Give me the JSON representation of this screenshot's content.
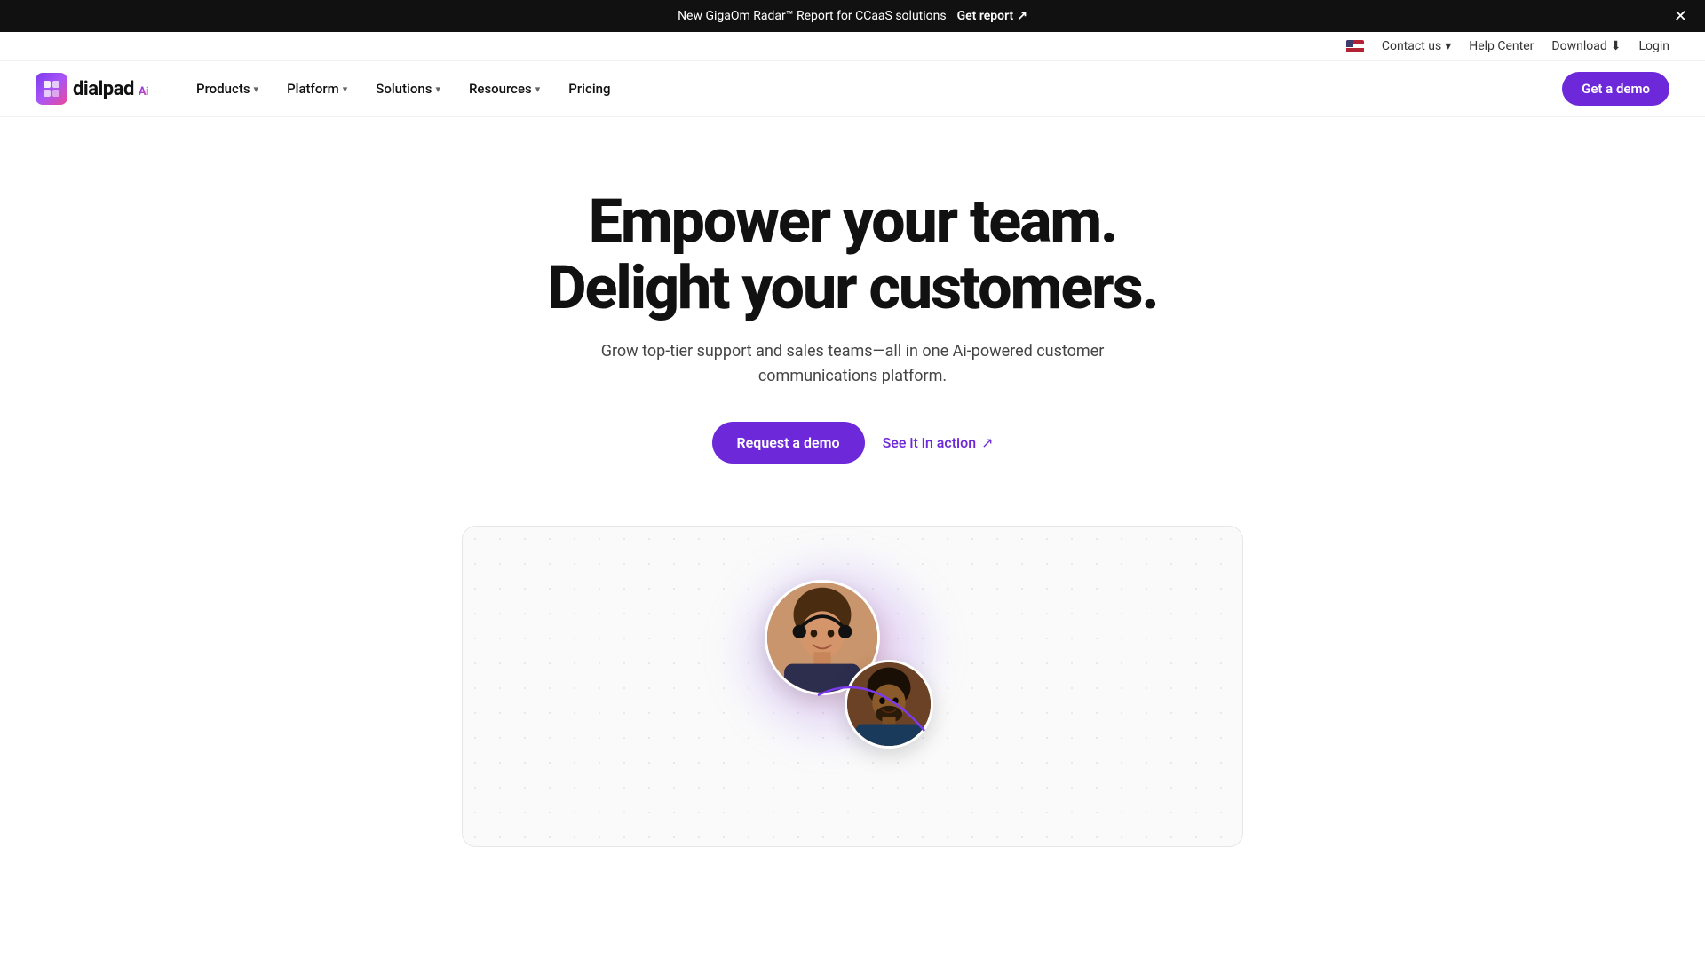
{
  "announcement": {
    "text": "New GigaOm Radar™ Report for CCaaS solutions",
    "cta_label": "Get report",
    "cta_icon": "↗"
  },
  "utility_nav": {
    "contact_label": "Contact us",
    "contact_chevron": "▾",
    "help_label": "Help Center",
    "download_label": "Download",
    "download_icon": "⬇",
    "login_label": "Login"
  },
  "nav": {
    "logo_text": "dialpad",
    "logo_ai": "Ai",
    "items": [
      {
        "label": "Products",
        "has_dropdown": true
      },
      {
        "label": "Platform",
        "has_dropdown": true
      },
      {
        "label": "Solutions",
        "has_dropdown": true
      },
      {
        "label": "Resources",
        "has_dropdown": true
      },
      {
        "label": "Pricing",
        "has_dropdown": false
      }
    ],
    "cta_label": "Get a demo"
  },
  "hero": {
    "headline_line1": "Empower your team.",
    "headline_line2": "Delight your customers.",
    "subtext": "Grow top-tier support and sales teams—all in one Ai-powered customer communications platform.",
    "btn_primary": "Request a demo",
    "btn_secondary": "See it in action",
    "btn_secondary_icon": "↗"
  }
}
